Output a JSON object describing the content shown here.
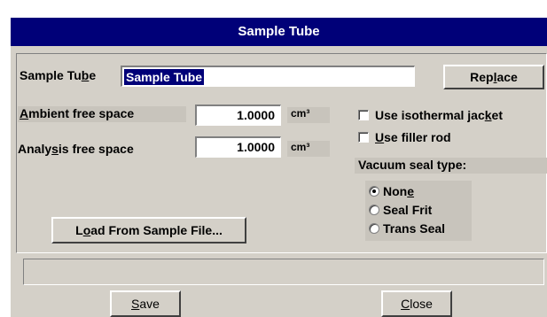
{
  "window": {
    "title": "Sample Tube"
  },
  "sample_tube": {
    "label_pre": "Sample Tu",
    "label_key": "b",
    "label_post": "e",
    "value": "Sample Tube",
    "replace_pre": "Rep",
    "replace_key": "l",
    "replace_post": "ace"
  },
  "ambient": {
    "label_key": "A",
    "label_post": "mbient free space",
    "value": "1.0000",
    "unit": "cm³"
  },
  "analysis": {
    "label_pre": "Analy",
    "label_key": "s",
    "label_post": "is free space",
    "value": "1.0000",
    "unit": "cm³"
  },
  "options": {
    "isothermal_pre": "Use isothermal jac",
    "isothermal_key": "k",
    "isothermal_post": "et",
    "isothermal_checked": false,
    "filler_key": "U",
    "filler_post": "se filler rod",
    "filler_checked": false
  },
  "vacuum": {
    "title": "Vacuum seal type:",
    "none_pre": "Non",
    "none_key": "e",
    "seal_frit": "Seal Frit",
    "trans_seal": "Trans Seal",
    "selected": "None"
  },
  "load_button": {
    "pre": "L",
    "key": "o",
    "post": "ad From Sample File..."
  },
  "status_bar": {
    "text": ""
  },
  "footer": {
    "save_key": "S",
    "save_post": "ave",
    "close_key": "C",
    "close_post": "lose"
  },
  "colors": {
    "title_bar": "#000078",
    "face": "#d4d0c8",
    "selection": "#000078"
  }
}
